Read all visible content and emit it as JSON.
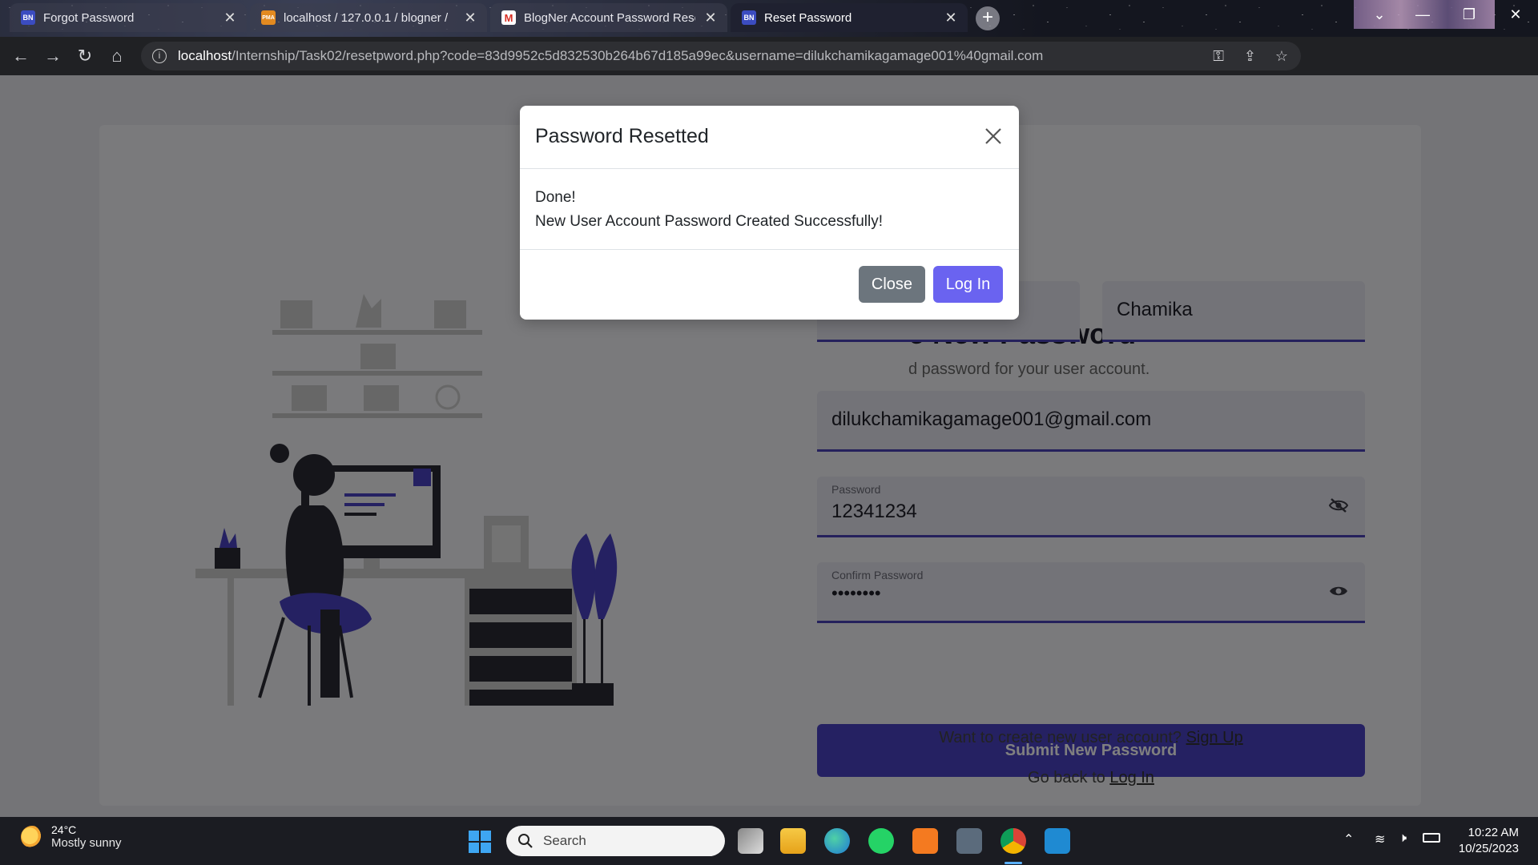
{
  "browser": {
    "tabs": [
      {
        "title": "Forgot Password",
        "favicon": "BN",
        "active": false
      },
      {
        "title": "localhost / 127.0.0.1 / blogner /",
        "favicon": "PMA",
        "active": false
      },
      {
        "title": "BlogNer Account Password Rese",
        "favicon": "M",
        "active": false
      },
      {
        "title": "Reset Password",
        "favicon": "BN",
        "active": true
      }
    ],
    "url_host": "localhost",
    "url_path": "/Internship/Task02/resetpword.php?code=83d9952c5d832530b264b67d185a99ec&username=dilukchamikagamage001%40gmail.com"
  },
  "page": {
    "heading": "e New Password",
    "subheading": "d password for your user account.",
    "last_name": "Chamika",
    "email": "dilukchamikagamage001@gmail.com",
    "password_label": "Password",
    "password_value": "12341234",
    "confirm_label": "Confirm Password",
    "confirm_value": "••••••••",
    "submit_label": "Submit New Password",
    "signup_prompt": "Want to create new user account?",
    "signup_link": "Sign Up",
    "back_prompt": "Go back to",
    "login_link": "Log In"
  },
  "modal": {
    "title": "Password Resetted",
    "line1": "Done!",
    "line2": "New User Account Password Created Successfully!",
    "close_label": "Close",
    "login_label": "Log In"
  },
  "taskbar": {
    "temperature": "24°C",
    "condition": "Mostly sunny",
    "search_placeholder": "Search",
    "time": "10:22 AM",
    "date": "10/25/2023"
  },
  "colors": {
    "accent": "#4a43c4",
    "modal_primary": "#6a63f0",
    "modal_secondary": "#6c757d"
  }
}
